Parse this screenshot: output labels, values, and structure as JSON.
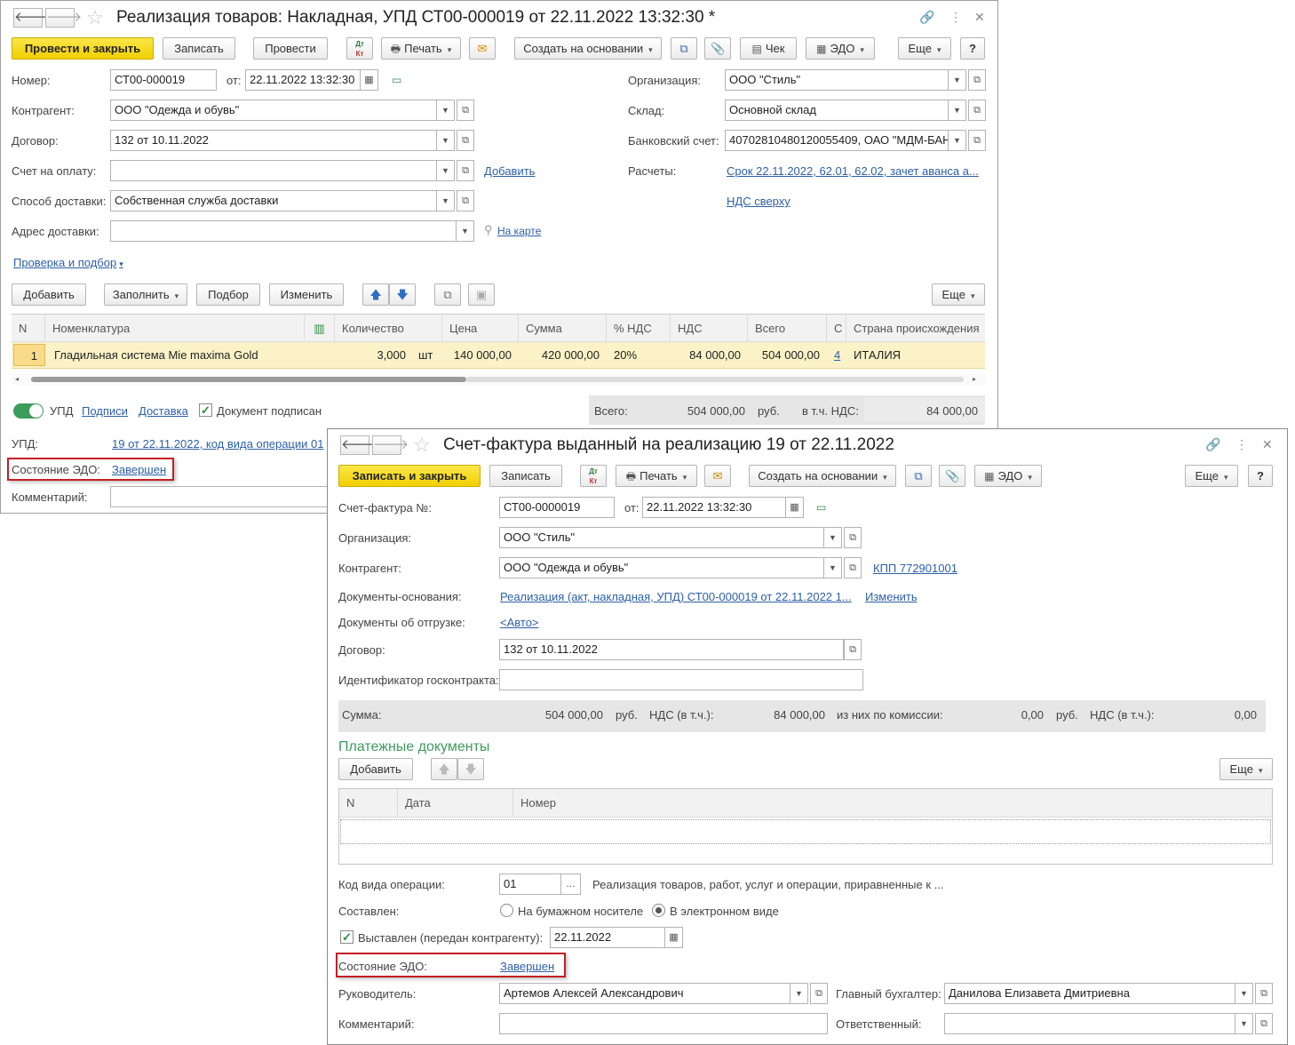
{
  "w1": {
    "title": "Реализация товаров: Накладная, УПД СТ00-000019 от 22.11.2022 13:32:30 *",
    "toolbar": {
      "post_close": "Провести и закрыть",
      "save": "Записать",
      "post": "Провести",
      "print": "Печать",
      "create_based": "Создать на основании",
      "check": "Чек",
      "edo": "ЭДО",
      "more": "Еще",
      "help": "?"
    },
    "fields": {
      "number_label": "Номер:",
      "number": "СТ00-000019",
      "from_label": "от:",
      "date": "22.11.2022 13:32:30",
      "org_label": "Организация:",
      "org": "ООО \"Стиль\"",
      "contragent_label": "Контрагент:",
      "contragent": "ООО \"Одежда и обувь\"",
      "warehouse_label": "Склад:",
      "warehouse": "Основной склад",
      "contract_label": "Договор:",
      "contract": "132 от 10.11.2022",
      "bank_label": "Банковский счет:",
      "bank": "40702810480120055409, ОАО \"МДМ-БАНК\"",
      "invoice_label": "Счет на оплату:",
      "invoice": "",
      "add_link": "Добавить",
      "settlements_label": "Расчеты:",
      "settlements": "Срок 22.11.2022, 62.01, 62.02, зачет аванса а...",
      "delivery_method_label": "Способ доставки:",
      "delivery_method": "Собственная служба доставки",
      "vat_link": "НДС сверху",
      "delivery_address_label": "Адрес доставки:",
      "delivery_address": "",
      "map_link": "На карте",
      "check_link": "Проверка и подбор"
    },
    "table_toolbar": {
      "add": "Добавить",
      "fill": "Заполнить",
      "select": "Подбор",
      "change": "Изменить",
      "more": "Еще"
    },
    "table": {
      "headers": [
        "N",
        "Номенклатура",
        "",
        "Количество",
        "Цена",
        "Сумма",
        "% НДС",
        "НДС",
        "Всего",
        "С",
        "Страна происхождения"
      ],
      "rows": [
        {
          "n": "1",
          "name": "Гладильная система Mie maxima Gold",
          "qty": "3,000",
          "unit": "шт",
          "price": "140 000,00",
          "sum": "420 000,00",
          "vat_rate": "20%",
          "vat": "84 000,00",
          "total": "504 000,00",
          "s": "4",
          "country": "ИТАЛИЯ"
        }
      ]
    },
    "bottom": {
      "upd_toggle": "УПД",
      "signatures": "Подписи",
      "delivery": "Доставка",
      "signed": "Документ подписан",
      "total_label": "Всего:",
      "total": "504 000,00",
      "rub": "руб.",
      "incl_vat_label": "в т.ч. НДС:",
      "incl_vat": "84 000,00",
      "upd_label": "УПД:",
      "upd_link": "19 от 22.11.2022, код вида операции 01",
      "edo_state_label": "Состояние ЭДО:",
      "edo_state": "Завершен",
      "comment_label": "Комментарий:"
    }
  },
  "w2": {
    "title": "Счет-фактура выданный на реализацию 19 от 22.11.2022",
    "toolbar": {
      "save_close": "Записать и закрыть",
      "save": "Записать",
      "print": "Печать",
      "create_based": "Создать на основании",
      "edo": "ЭДО",
      "more": "Еще",
      "help": "?"
    },
    "fields": {
      "inv_no_label": "Счет-фактура №:",
      "inv_no": "СТ00-0000019",
      "from_label": "от:",
      "date": "22.11.2022 13:32:30",
      "org_label": "Организация:",
      "org": "ООО \"Стиль\"",
      "contragent_label": "Контрагент:",
      "contragent": "ООО \"Одежда и обувь\"",
      "kpp_link": "КПП 772901001",
      "base_docs_label": "Документы-основания:",
      "base_docs_link": "Реализация (акт, накладная, УПД) СТ00-000019 от 22.11.2022 1...",
      "change_link": "Изменить",
      "ship_docs_label": "Документы об отгрузке:",
      "ship_docs_link": "<Авто>",
      "contract_label": "Договор:",
      "contract": "132 от 10.11.2022",
      "gov_id_label": "Идентификатор госконтракта:",
      "gov_id": ""
    },
    "sums": {
      "sum_label": "Сумма:",
      "sum": "504 000,00",
      "rub": "руб.",
      "vat_label": "НДС (в т.ч.):",
      "vat": "84 000,00",
      "commission_label": "из них по комиссии:",
      "commission": "0,00",
      "rub2": "руб.",
      "vat2_label": "НДС (в т.ч.):",
      "vat2": "0,00"
    },
    "payments": {
      "title": "Платежные документы",
      "add": "Добавить",
      "more": "Еще",
      "headers": [
        "N",
        "Дата",
        "Номер"
      ]
    },
    "bottom": {
      "op_code_label": "Код вида операции:",
      "op_code": "01",
      "op_code_desc": "Реализация товаров, работ, услуг и операции, приравненные к ...",
      "composed_label": "Составлен:",
      "paper": "На бумажном носителе",
      "electronic": "В электронном виде",
      "issued_label": "Выставлен (передан контрагенту):",
      "issued_date": "22.11.2022",
      "edo_state_label": "Состояние ЭДО:",
      "edo_state": "Завершен",
      "head_label": "Руководитель:",
      "head": "Артемов Алексей Александрович",
      "chief_acc_label": "Главный бухгалтер:",
      "chief_acc": "Данилова Елизавета Дмитриевна",
      "comment_label": "Комментарий:",
      "responsible_label": "Ответственный:"
    }
  }
}
